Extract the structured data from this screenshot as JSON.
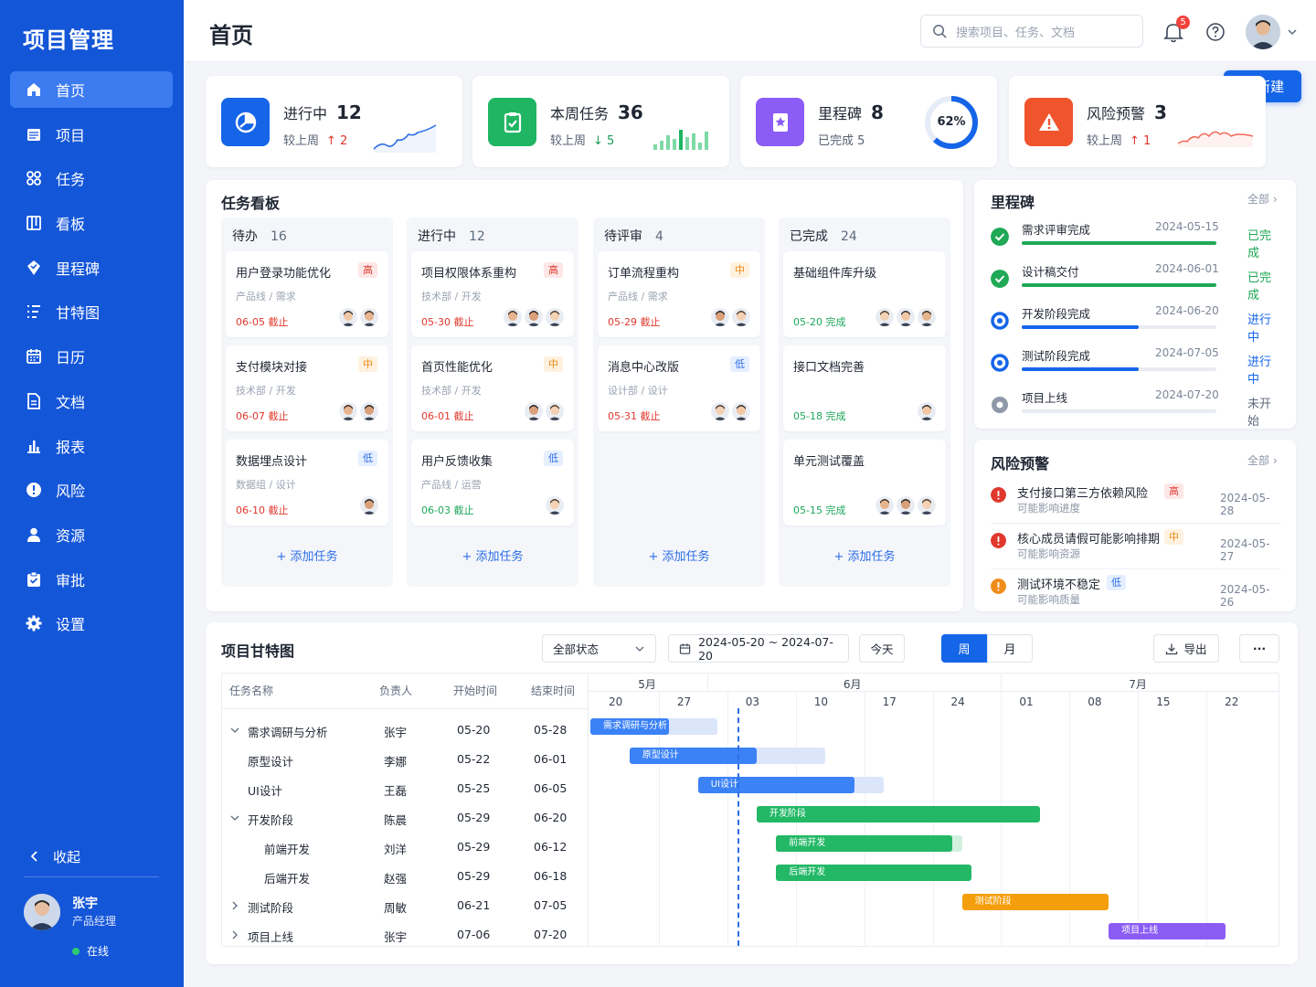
{
  "app": {
    "title": "项目管理"
  },
  "nav": [
    {
      "label": "首页",
      "icon": "home-icon",
      "active": true
    },
    {
      "label": "项目",
      "icon": "folder-icon"
    },
    {
      "label": "任务",
      "icon": "task-icon"
    },
    {
      "label": "看板",
      "icon": "board-icon"
    },
    {
      "label": "里程碑",
      "icon": "milestone-icon"
    },
    {
      "label": "甘特图",
      "icon": "gantt-icon"
    },
    {
      "label": "日历",
      "icon": "calendar-icon"
    },
    {
      "label": "文档",
      "icon": "document-icon"
    },
    {
      "label": "报表",
      "icon": "chart-icon"
    },
    {
      "label": "风险",
      "icon": "risk-icon"
    },
    {
      "label": "资源",
      "icon": "user-icon"
    },
    {
      "label": "审批",
      "icon": "approval-icon"
    },
    {
      "label": "设置",
      "icon": "gear-icon"
    }
  ],
  "sidebar": {
    "collapse": "收起",
    "user_name": "张宇",
    "user_role": "产品经理",
    "status": "在线"
  },
  "header": {
    "title": "首页",
    "search_placeholder": "搜索项目、任务、文档",
    "notifications": "5",
    "new_button": "+ 新建"
  },
  "stats": [
    {
      "label": "进行中",
      "value": "12",
      "sub": "较上周",
      "change": "↑ 2",
      "dir": "up",
      "color": "#1565e8"
    },
    {
      "label": "本周任务",
      "value": "36",
      "sub": "较上周",
      "change": "↓ 5",
      "dir": "down",
      "color": "#1fb563"
    },
    {
      "label": "里程碑",
      "value": "8",
      "sub": "已完成 5",
      "change": "",
      "dir": "",
      "color": "#8b5cf6",
      "progress": 0.62,
      "progress_label": "62%"
    },
    {
      "label": "风险预警",
      "value": "3",
      "sub": "较上周",
      "change": "↑ 1",
      "dir": "up",
      "color": "#f0542d"
    }
  ],
  "board": {
    "title": "任务看板",
    "add_label": "+ 添加任务",
    "columns": [
      {
        "name": "待办",
        "count": "16",
        "tasks": [
          {
            "title": "用户登录功能优化",
            "tag": "高",
            "level": "h",
            "meta": "产品线 / 需求",
            "due": "06-05 截止",
            "done": false,
            "avatars": 2
          },
          {
            "title": "支付模块对接",
            "tag": "中",
            "level": "m",
            "meta": "技术部 / 开发",
            "due": "06-07 截止",
            "done": false,
            "avatars": 2
          },
          {
            "title": "数据埋点设计",
            "tag": "低",
            "level": "l",
            "meta": "数据组 / 设计",
            "due": "06-10 截止",
            "done": false,
            "avatars": 1
          }
        ]
      },
      {
        "name": "进行中",
        "count": "12",
        "tasks": [
          {
            "title": "项目权限体系重构",
            "tag": "高",
            "level": "h",
            "meta": "技术部 / 开发",
            "due": "05-30 截止",
            "done": false,
            "avatars": 3
          },
          {
            "title": "首页性能优化",
            "tag": "中",
            "level": "m",
            "meta": "技术部 / 开发",
            "due": "06-01 截止",
            "done": false,
            "avatars": 2
          },
          {
            "title": "用户反馈收集",
            "tag": "低",
            "level": "l",
            "meta": "产品线 / 运营",
            "due": "06-03 截止",
            "done": true,
            "avatars": 1
          }
        ]
      },
      {
        "name": "待评审",
        "count": "4",
        "tasks": [
          {
            "title": "订单流程重构",
            "tag": "中",
            "level": "m",
            "meta": "产品线 / 需求",
            "due": "05-29 截止",
            "done": false,
            "avatars": 2
          },
          {
            "title": "消息中心改版",
            "tag": "低",
            "level": "l",
            "meta": "设计部 / 设计",
            "due": "05-31 截止",
            "done": false,
            "avatars": 2
          }
        ]
      },
      {
        "name": "已完成",
        "count": "24",
        "tasks": [
          {
            "title": "基础组件库升级",
            "tag": "",
            "level": "",
            "meta": "",
            "due": "05-20 完成",
            "done": true,
            "avatars": 3
          },
          {
            "title": "接口文档完善",
            "tag": "",
            "level": "",
            "meta": "",
            "due": "05-18 完成",
            "done": true,
            "avatars": 1
          },
          {
            "title": "单元测试覆盖",
            "tag": "",
            "level": "",
            "meta": "",
            "due": "05-15 完成",
            "done": true,
            "avatars": 3
          }
        ]
      }
    ]
  },
  "milestones": {
    "title": "里程碑",
    "more": "全部 ›",
    "items": [
      {
        "name": "需求评审完成",
        "date": "2024-05-15",
        "status": "已完成",
        "progress": 1.0,
        "state": "done"
      },
      {
        "name": "设计稿交付",
        "date": "2024-06-01",
        "status": "已完成",
        "progress": 1.0,
        "state": "done"
      },
      {
        "name": "开发阶段完成",
        "date": "2024-06-20",
        "status": "进行中",
        "progress": 0.6,
        "state": "doing"
      },
      {
        "name": "测试阶段完成",
        "date": "2024-07-05",
        "status": "进行中",
        "progress": 0.6,
        "state": "doing"
      },
      {
        "name": "项目上线",
        "date": "2024-07-20",
        "status": "未开始",
        "progress": 0,
        "state": "todo"
      }
    ]
  },
  "risks": {
    "title": "风险预警",
    "more": "全部 ›",
    "items": [
      {
        "title": "支付接口第三方依赖风险",
        "tag": "高",
        "level": "h",
        "sub": "可能影响进度",
        "date": "2024-05-28",
        "color": "#e0382d"
      },
      {
        "title": "核心成员请假可能影响排期",
        "tag": "中",
        "level": "m",
        "sub": "可能影响资源",
        "date": "2024-05-27",
        "color": "#e0382d"
      },
      {
        "title": "测试环境不稳定",
        "tag": "低",
        "level": "l",
        "sub": "可能影响质量",
        "date": "2024-05-26",
        "color": "#f08c1a"
      }
    ]
  },
  "gantt": {
    "title": "项目甘特图",
    "status_filter": "全部状态",
    "range": "2024-05-20 ~ 2024-07-20",
    "today": "今天",
    "view_week": "周",
    "view_month": "月",
    "export": "导出",
    "more": "···",
    "headers": [
      "任务名称",
      "负责人",
      "开始时间",
      "结束时间"
    ],
    "months": [
      "5月",
      "6月",
      "7月"
    ],
    "weeks": [
      "20",
      "27",
      "03",
      "10",
      "17",
      "24",
      "01",
      "08",
      "15",
      "22"
    ],
    "rows": [
      {
        "name": "需求调研与分析",
        "owner": "张宇",
        "start": "05-20",
        "end": "05-28",
        "level": 0,
        "expand": "open"
      },
      {
        "name": "原型设计",
        "owner": "李娜",
        "start": "05-22",
        "end": "06-01",
        "level": 1,
        "expand": ""
      },
      {
        "name": "UI设计",
        "owner": "王磊",
        "start": "05-25",
        "end": "06-05",
        "level": 1,
        "expand": ""
      },
      {
        "name": "开发阶段",
        "owner": "陈晨",
        "start": "05-29",
        "end": "06-20",
        "level": 0,
        "expand": "open"
      },
      {
        "name": "前端开发",
        "owner": "刘洋",
        "start": "05-29",
        "end": "06-12",
        "level": 2,
        "expand": ""
      },
      {
        "name": "后端开发",
        "owner": "赵强",
        "start": "05-29",
        "end": "06-18",
        "level": 2,
        "expand": ""
      },
      {
        "name": "测试阶段",
        "owner": "周敏",
        "start": "06-21",
        "end": "07-05",
        "level": 0,
        "expand": "closed"
      },
      {
        "name": "项目上线",
        "owner": "张宇",
        "start": "07-06",
        "end": "07-20",
        "level": 0,
        "expand": "closed"
      }
    ],
    "bars": [
      {
        "label": "需求调研与分析",
        "color": "#3b82f6",
        "start": "2024-05-20",
        "end": "2024-05-28",
        "shadow_end": "2024-06-02"
      },
      {
        "label": "原型设计",
        "color": "#3b82f6",
        "start": "2024-05-24",
        "end": "2024-06-06",
        "shadow_end": "2024-06-13"
      },
      {
        "label": "UI设计",
        "color": "#3b82f6",
        "start": "2024-05-31",
        "end": "2024-06-16",
        "shadow_end": "2024-06-19"
      },
      {
        "label": "开发阶段",
        "color": "#22b866",
        "start": "2024-06-06",
        "end": "2024-07-05"
      },
      {
        "label": "前端开发",
        "color": "#22b866",
        "start": "2024-06-08",
        "end": "2024-06-26",
        "shadow_end": "2024-06-27"
      },
      {
        "label": "后端开发",
        "color": "#22b866",
        "start": "2024-06-08",
        "end": "2024-06-28"
      },
      {
        "label": "测试阶段",
        "color": "#f59e0b",
        "start": "2024-06-27",
        "end": "2024-07-12"
      },
      {
        "label": "项目上线",
        "color": "#8b5cf6",
        "start": "2024-07-12",
        "end": "2024-07-24"
      }
    ],
    "today_date": "2024-06-04"
  }
}
